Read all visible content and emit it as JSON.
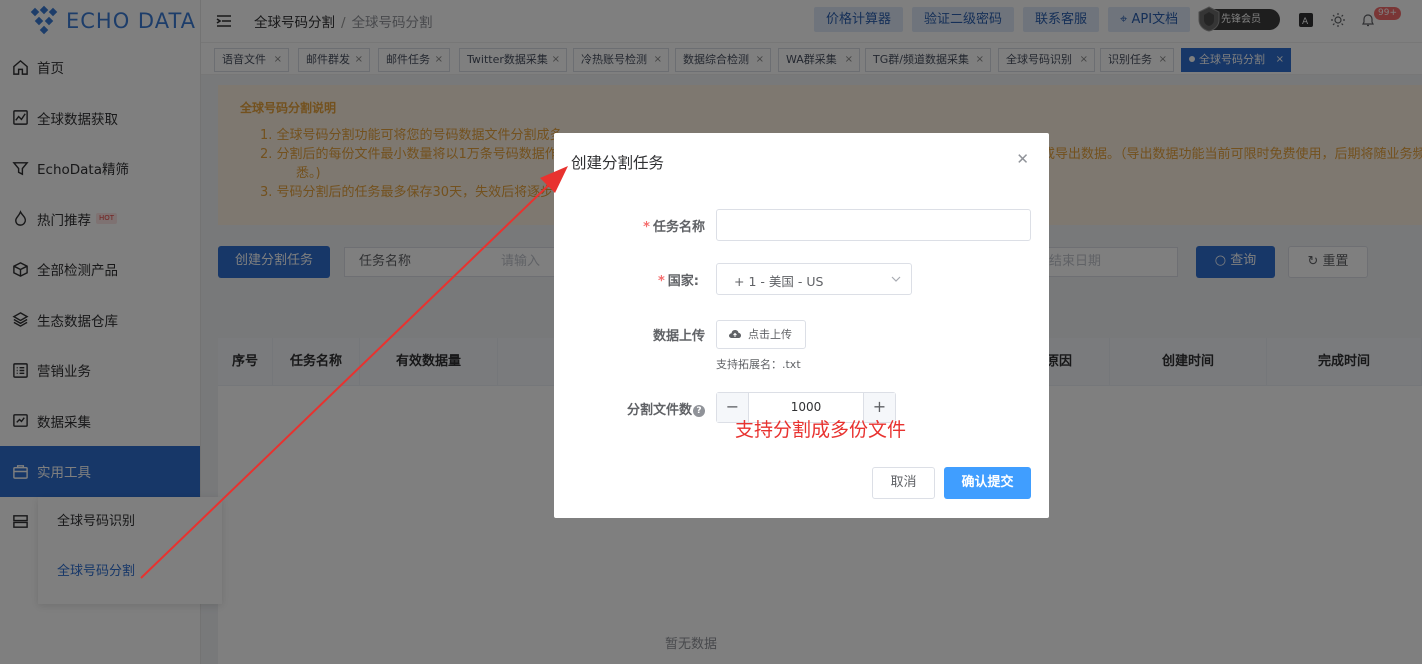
{
  "app": {
    "logo_text": "ECHO DATA"
  },
  "sidebar": {
    "items": [
      {
        "label": "首页",
        "icon": "home-icon"
      },
      {
        "label": "全球数据获取",
        "icon": "chart-icon"
      },
      {
        "label": "EchoData精筛",
        "icon": "filter-icon"
      },
      {
        "label": "热门推荐",
        "icon": "fire-icon",
        "badge": "HOT"
      },
      {
        "label": "全部检测产品",
        "icon": "cube-icon"
      },
      {
        "label": "生态数据仓库",
        "icon": "layers-icon"
      },
      {
        "label": "营销业务",
        "icon": "list-icon"
      },
      {
        "label": "数据采集",
        "icon": "collect-icon"
      },
      {
        "label": "实用工具",
        "icon": "briefcase-icon",
        "active": true
      },
      {
        "label": "",
        "icon": "server-icon"
      }
    ],
    "submenu": [
      {
        "label": "全球号码识别"
      },
      {
        "label": "全球号码分割",
        "active": true
      }
    ]
  },
  "header": {
    "breadcrumb": [
      "全球号码分割",
      "全球号码分割"
    ],
    "buttons": [
      "价格计算器",
      "验证二级密码",
      "联系客服",
      "API文档"
    ],
    "member_label": "先锋会员",
    "notification_count": "99+"
  },
  "tabs": [
    "语音文件",
    "邮件群发",
    "邮件任务",
    "Twitter数据采集",
    "冷热账号检测",
    "数据综合检测",
    "WA群采集",
    "TG群/频道数据采集",
    "全球号码识别",
    "识别任务",
    "全球号码分割"
  ],
  "notice": {
    "title": "全球号码分割说明",
    "lines": [
      "1. 全球号码分割功能可将您的号码数据文件分割成多",
      "2. 分割后的每份文件最小数量将以1万条号码数据作为",
      "悉。)",
      "3. 号码分割后的任务最多保存30天，失效后将逐步"
    ],
    "line2_tail": "或导出数据。（导出数据功能当前可限时免费使用，后期将随业务频"
  },
  "filter": {
    "create_button": "创建分割任务",
    "task_name_label": "任务名称",
    "task_name_placeholder": "请输入",
    "end_date_placeholder": "结束日期",
    "query_button": "查询",
    "reset_button": "重置"
  },
  "table": {
    "columns": [
      "序号",
      "任务名称",
      "有效数据量",
      "原因",
      "创建时间",
      "完成时间"
    ],
    "empty_text": "暂无数据"
  },
  "dialog": {
    "title": "创建分割任务",
    "task_name_label": "任务名称",
    "task_name_value": "",
    "country_label": "国家:",
    "country_value": "+ 1 - 美国 - US",
    "upload_label": "数据上传",
    "upload_button": "点击上传",
    "upload_hint": "支持拓展名：.txt",
    "split_label": "分割文件数",
    "split_value": "1000",
    "annotation": "支持分割成多份文件",
    "cancel_button": "取消",
    "confirm_button": "确认提交"
  },
  "colors": {
    "primary": "#2f6fd1",
    "annotation": "#e8322f",
    "notice_text": "#e6a23c"
  }
}
